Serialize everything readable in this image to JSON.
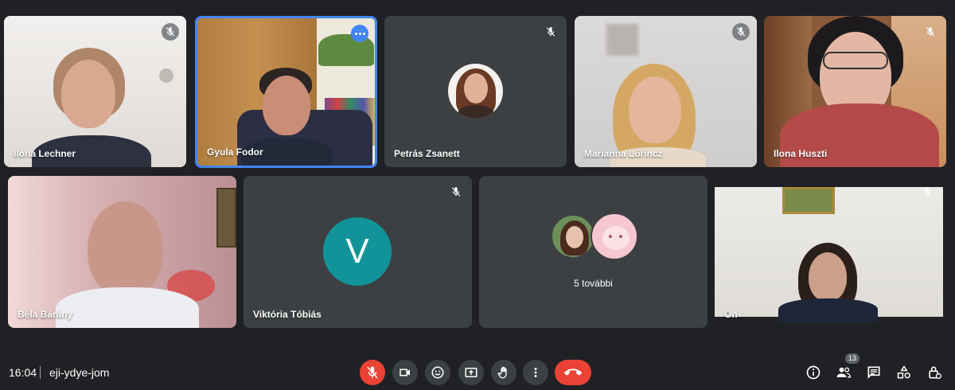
{
  "participants": [
    {
      "name": "Ilona Lechner",
      "muted": true
    },
    {
      "name": "Gyula Fodor",
      "muted": false,
      "speaking": true
    },
    {
      "name": "Petrás Zsanett",
      "muted": true
    },
    {
      "name": "Marianna Lőrincz",
      "muted": true
    },
    {
      "name": "Ilona Huszti",
      "muted": true
    },
    {
      "name": "Béla Bárány",
      "muted": false
    },
    {
      "name": "Viktória Tóbiás",
      "muted": true,
      "avatar_letter": "V",
      "avatar_color": "#12939a"
    },
    {
      "name": "Ön",
      "muted": true
    }
  ],
  "others_tile": {
    "label": "5 további"
  },
  "meeting": {
    "time": "16:04",
    "code": "eji-ydye-jom"
  },
  "controls": {
    "mic": {
      "icon": "mic-off-icon",
      "color": "#ea4335"
    },
    "camera": {
      "icon": "videocam-icon"
    },
    "reactions": {
      "icon": "emoji-icon"
    },
    "present": {
      "icon": "present-screen-icon"
    },
    "raise_hand": {
      "icon": "hand-icon"
    },
    "more": {
      "icon": "more-vert-icon"
    },
    "hangup": {
      "icon": "call-end-icon",
      "color": "#ea4335"
    }
  },
  "side_controls": {
    "people_count": "13",
    "icons": [
      "info-icon",
      "people-icon",
      "chat-icon",
      "activities-icon",
      "host-controls-icon"
    ]
  },
  "colors": {
    "background": "#202124",
    "tile": "#3c4043",
    "accent": "#4285f4"
  }
}
